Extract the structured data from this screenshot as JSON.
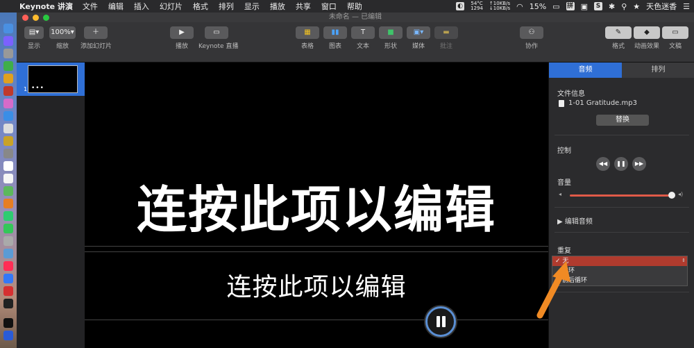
{
  "menubar": {
    "app_name": "Keynote 讲演",
    "items": [
      "文件",
      "编辑",
      "插入",
      "幻灯片",
      "格式",
      "排列",
      "显示",
      "播放",
      "共享",
      "窗口",
      "帮助"
    ],
    "temp": "54°C",
    "fan": "1294",
    "net_up": "↑10KB/s",
    "net_down": "↓10KB/s",
    "battery": "15%",
    "user_name": "天色迷香"
  },
  "window": {
    "title": "未命名 — 已编辑"
  },
  "toolbar": {
    "view_label": "显示",
    "zoom_value": "100%",
    "zoom_label": "缩放",
    "add_slide_label": "添加幻灯片",
    "play_label": "播放",
    "keynote_live_label": "Keynote 直播",
    "table_label": "表格",
    "chart_label": "图表",
    "text_label": "文本",
    "shape_label": "形状",
    "media_label": "媒体",
    "comment_label": "批注",
    "collaborate_label": "协作",
    "format_label": "格式",
    "animate_label": "动画效果",
    "document_label": "文稿"
  },
  "slides": [
    {
      "number": "1"
    }
  ],
  "canvas": {
    "title": "连按此项以编辑",
    "subtitle": "连按此项以编辑"
  },
  "inspector": {
    "tab_audio": "音频",
    "tab_arrange": "排列",
    "file_info_label": "文件信息",
    "file_name": "1-01 Gratitude.mp3",
    "replace_label": "替换",
    "controls_label": "控制",
    "volume_label": "音量",
    "volume_level": 0.96,
    "edit_audio_label": "编辑音频",
    "repeat_label": "重复",
    "repeat_options": [
      "无",
      "循环",
      "前后循环"
    ],
    "repeat_selected": "无"
  },
  "colors": {
    "accent": "#2f6fd6",
    "volume_track": "#e05a48",
    "selected_option": "#b03b2e",
    "arrow": "#f08a24"
  }
}
